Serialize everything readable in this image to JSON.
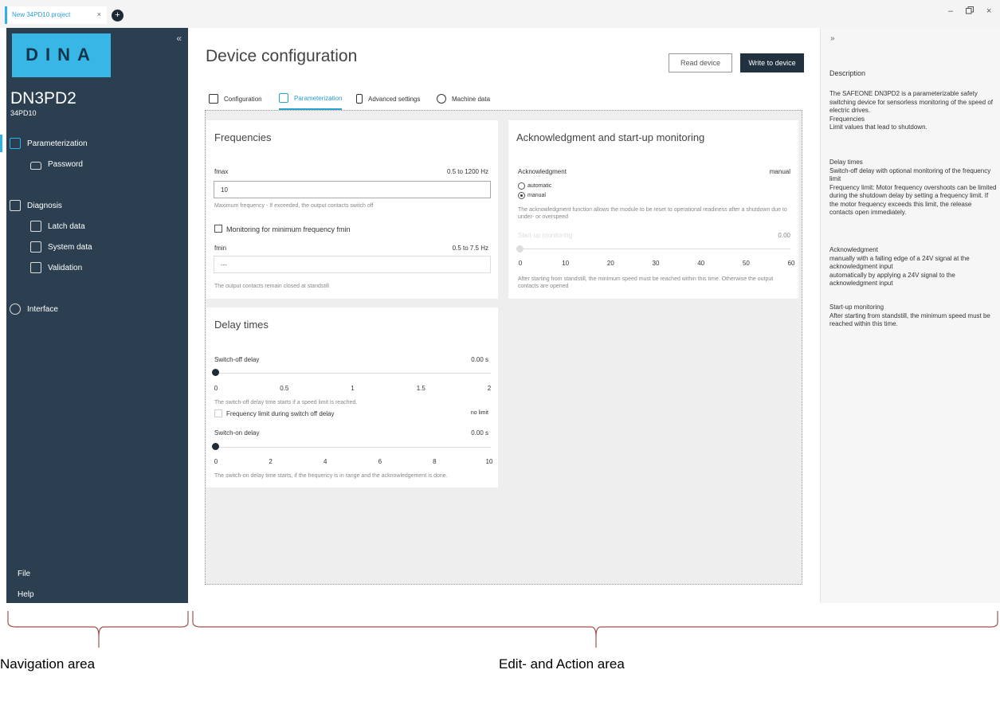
{
  "window": {
    "tab_title": "New 34PD10 project",
    "tab_close": "×",
    "new_tab": "+",
    "controls": [
      "–",
      "🗗",
      "×"
    ]
  },
  "sidebar": {
    "collapse": "«",
    "logo": "DINA",
    "device_name": "DN3PD2",
    "device_sub": "34PD10",
    "items": [
      {
        "label": "Parameterization",
        "icon": "parameter-icon",
        "active": true
      },
      {
        "label": "Password",
        "icon": "lock-icon"
      },
      {
        "label": "Diagnosis",
        "icon": "diagnosis-icon"
      },
      {
        "label": "Latch data",
        "icon": "latch-data-icon"
      },
      {
        "label": "System data",
        "icon": "system-data-icon"
      },
      {
        "label": "Validation",
        "icon": "validation-icon"
      },
      {
        "label": "Interface",
        "icon": "interface-icon"
      }
    ],
    "bottom": {
      "file": "File",
      "help": "Help"
    },
    "accent_color": "#2cb1e8",
    "bg_color": "#2b3f51"
  },
  "header": {
    "title": "Device configuration",
    "read_button": "Read device",
    "write_button": "Write to device"
  },
  "tabs": [
    {
      "label": "Configuration",
      "icon": "configuration-icon"
    },
    {
      "label": "Parameterization",
      "icon": "parameterization-icon",
      "active": true
    },
    {
      "label": "Advanced settings",
      "icon": "advanced-settings-icon"
    },
    {
      "label": "Machine data",
      "icon": "machine-data-icon"
    }
  ],
  "frequencies": {
    "title": "Frequencies",
    "fmax_label": "fmax",
    "fmax_range": "0.5 to 1200 Hz",
    "fmax_value": "10",
    "fmax_hint": "Maximum frequency - If exceeded, the output contacts switch off",
    "min_check_label": "Monitoring for minimum frequency fmin",
    "fmin_label": "fmin",
    "fmin_range": "0.5 to 7.5 Hz",
    "fmin_value": "---",
    "fmin_hint": "The output contacts remain closed at standstill"
  },
  "ack": {
    "title": "Acknowledgment and start-up monitoring",
    "ack_label": "Acknowledgment",
    "ack_value": "manual",
    "opt_automatic": "automatic",
    "opt_manual": "manual",
    "ack_hint": "The acknowledgment function allows the module to be reset to operational readiness after a shutdown due to under- or overspeed",
    "startup_label": "Start-up monitoring",
    "startup_value": "0.00",
    "startup_ticks": [
      "0",
      "10",
      "20",
      "30",
      "40",
      "50",
      "60"
    ],
    "startup_hint": "After starting from standstill, the minimum speed must be reached within this time. Otherwise the output contacts are opened"
  },
  "delay": {
    "title": "Delay times",
    "switch_off_label": "Switch-off delay",
    "switch_off_value": "0.00 s",
    "switch_off_ticks": [
      "0",
      "0.5",
      "1",
      "1.5",
      "2"
    ],
    "switch_off_hint": "The switch-off delay time starts if a speed limit is reached.",
    "freq_limit_label": "Frequency limit during switch off delay",
    "freq_limit_value": "no limit",
    "switch_on_label": "Switch-on delay",
    "switch_on_value": "0.00 s",
    "switch_on_ticks": [
      "0",
      "2",
      "4",
      "6",
      "8",
      "10"
    ],
    "switch_on_hint": "The switch-on delay time starts, if the frequency is in range and the acknowledgement is done."
  },
  "right_panel": {
    "collapse": "»",
    "heading": "Description",
    "p1": "The SAFEONE DN3PD2 is a parameterizable safety switching device for sensorless monitoring of the speed of electric drives.\nFrequencies\nLimit values that lead to shutdown.",
    "p2": "Delay times\nSwitch-off delay with optional monitoring of the frequency limit\nFrequency limit: Motor frequency overshoots can be limited during the shutdown delay by setting a frequency limit. If the motor frequency exceeds this limit, the release contacts open immediately.",
    "p3": "Acknowledgment\nmanually with a falling edge of a 24V signal at the acknowledgment input\nautomatically by applying a 24V signal to the acknowledgment input",
    "p4": "Start-up monitoring\nAfter starting from standstill, the minimum speed must be reached within this time."
  },
  "annotations": {
    "nav_label": "Navigation area",
    "edit_label": "Edit- and Action area",
    "brace_color": "#a0524b"
  }
}
